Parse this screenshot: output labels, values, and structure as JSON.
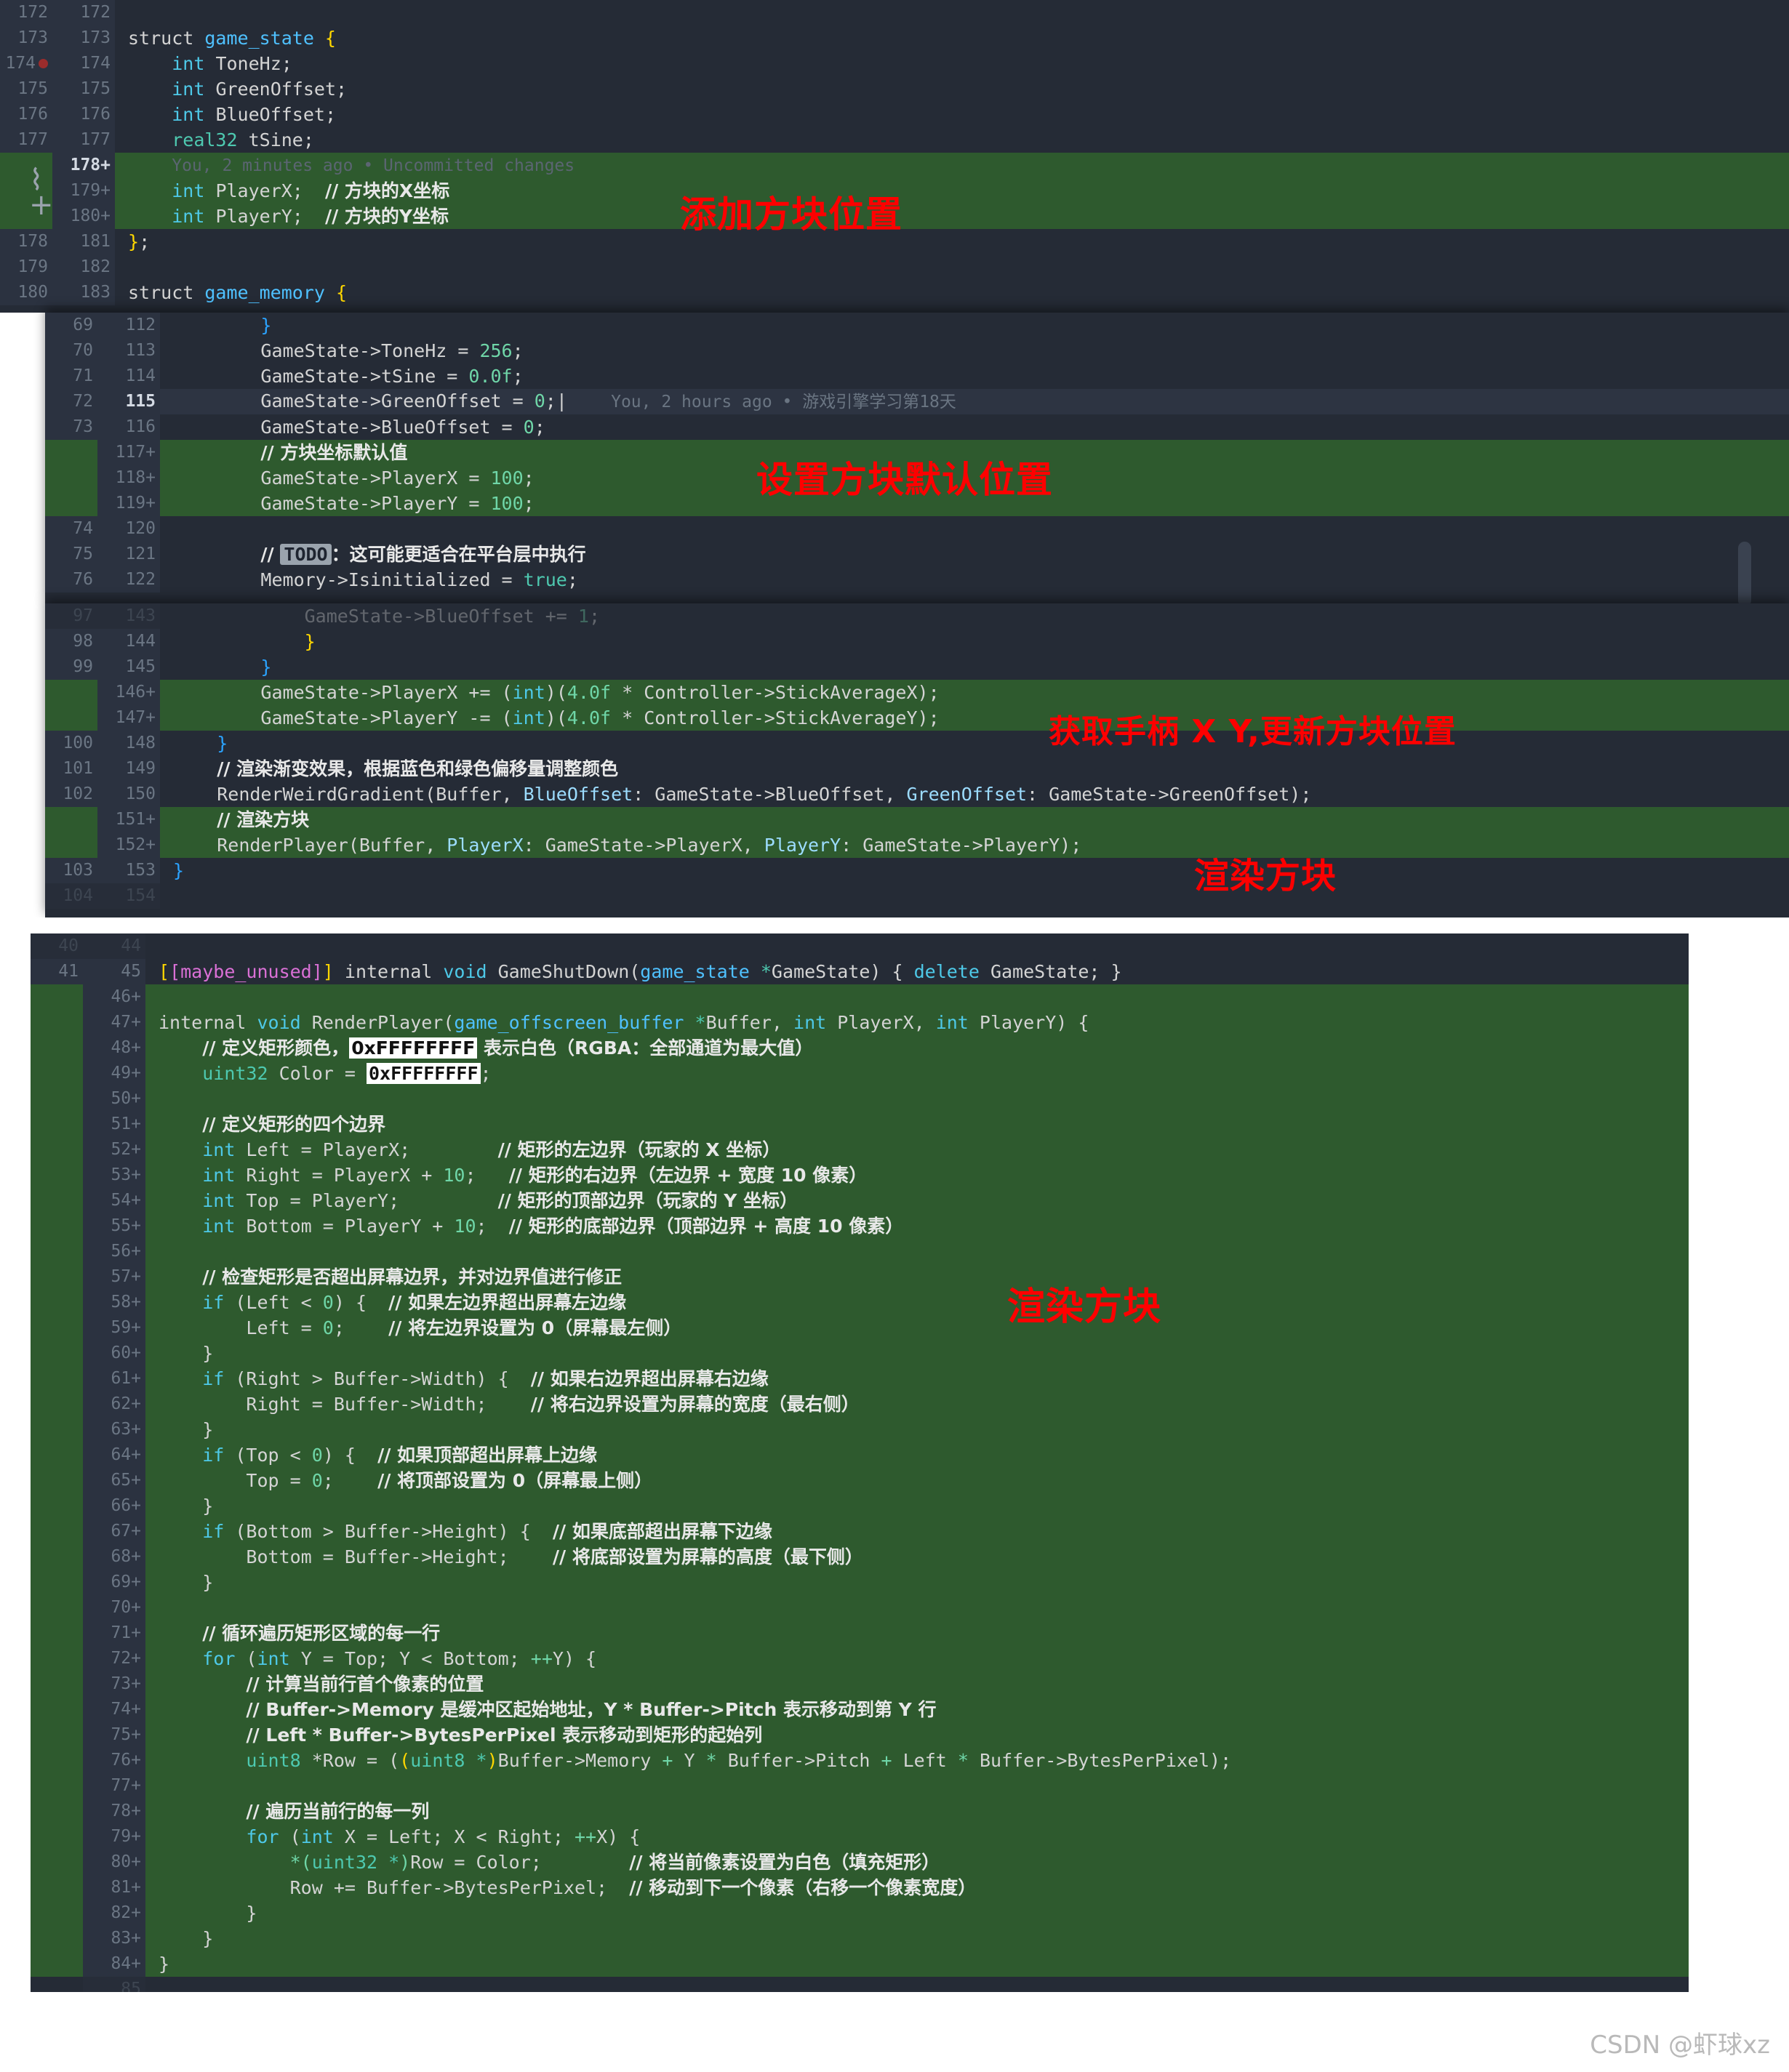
{
  "meta": {
    "watermark": "CSDN @虾球xz"
  },
  "panel_top": {
    "name": "game_state-struct-diff",
    "lines": [
      {
        "old": "172",
        "new": "172",
        "kind": "ctx",
        "html": ""
      },
      {
        "old": "173",
        "new": "173",
        "kind": "ctx",
        "html": "<span class='ident'>struct </span><span class='kw2'>game_state</span><span class='brace-y'> {</span>"
      },
      {
        "old": "174",
        "new": "174",
        "kind": "ctx",
        "bp": true,
        "html": "    <span class='kw'>int</span> <span class='ident'>ToneHz;</span>"
      },
      {
        "old": "175",
        "new": "175",
        "kind": "ctx",
        "html": "    <span class='kw'>int</span> <span class='ident'>GreenOffset;</span>"
      },
      {
        "old": "176",
        "new": "176",
        "kind": "ctx",
        "html": "    <span class='kw'>int</span> <span class='ident'>BlueOffset;</span>"
      },
      {
        "old": "177",
        "new": "177",
        "kind": "ctx",
        "html": "    <span class='type'>real32</span> <span class='ident'>tSine;</span>"
      },
      {
        "old": "",
        "new": "178+",
        "kind": "add",
        "cur": true,
        "html": "    <span class='blame'>You, 2 minutes ago • Uncommitted changes</span>"
      },
      {
        "old": "",
        "new": "179+",
        "kind": "add",
        "html": "    <span class='kw'>int</span> <span class='ident'>PlayerX;</span>  <span class='cmt-cn'>// 方块的X坐标</span>"
      },
      {
        "old": "",
        "new": "180+",
        "kind": "add",
        "html": "    <span class='kw'>int</span> <span class='ident'>PlayerY;</span>  <span class='cmt-cn'>// 方块的Y坐标</span>"
      },
      {
        "old": "178",
        "new": "181",
        "kind": "ctx",
        "html": "<span class='brace-y'>}</span><span class='ident'>;</span>"
      },
      {
        "old": "179",
        "new": "182",
        "kind": "ctx",
        "html": ""
      },
      {
        "old": "180",
        "new": "183",
        "kind": "ctx",
        "html": "<span class='ident'>struct </span><span class='kw2'>game_memory</span><span class='brace-y'> {</span>"
      }
    ],
    "annotation": "添加方块位置"
  },
  "panel_mid": {
    "name": "gamestate-init-diff",
    "lines": [
      {
        "old": "69",
        "new": "112",
        "kind": "ctx",
        "html": "        <span class='brace-b'>}</span>"
      },
      {
        "old": "70",
        "new": "113",
        "kind": "ctx",
        "html": "        <span class='ident'>GameState-&gt;ToneHz = </span><span class='num'>256</span><span class='ident'>;</span>"
      },
      {
        "old": "71",
        "new": "114",
        "kind": "ctx",
        "html": "        <span class='ident'>GameState-&gt;tSine = </span><span class='num'>0.0f</span><span class='ident'>;</span>"
      },
      {
        "old": "72",
        "new": "115",
        "kind": "cur",
        "html": "        <span class='ident'>GameState-&gt;GreenOffset = </span><span class='num'>0</span><span class='ident'>;|</span>    <span class='blame2'>You, 2 hours ago • 游戏引擎学习第18天</span>"
      },
      {
        "old": "73",
        "new": "116",
        "kind": "ctx",
        "html": "        <span class='ident'>GameState-&gt;BlueOffset = </span><span class='num'>0</span><span class='ident'>;</span>"
      },
      {
        "old": "",
        "new": "117+",
        "kind": "add",
        "html": "        <span class='cmt-cn'>// 方块坐标默认值</span>"
      },
      {
        "old": "",
        "new": "118+",
        "kind": "add",
        "html": "        <span class='ident'>GameState-&gt;PlayerX = </span><span class='num'>100</span><span class='ident'>;</span>"
      },
      {
        "old": "",
        "new": "119+",
        "kind": "add",
        "html": "        <span class='ident'>GameState-&gt;PlayerY = </span><span class='num'>100</span><span class='ident'>;</span>"
      },
      {
        "old": "74",
        "new": "120",
        "kind": "ctx",
        "html": ""
      },
      {
        "old": "75",
        "new": "121",
        "kind": "ctx",
        "html": "        <span class='cmt-cn'>// <span class='todo-chip'>TODO</span>：这可能更适合在平台层中执行</span>"
      },
      {
        "old": "76",
        "new": "122",
        "kind": "ctx",
        "html": "        <span class='ident'>Memory-&gt;Isinitialized = </span><span class='bool'>true</span><span class='ident'>;</span>"
      }
    ],
    "annotation": "设置方块默认位置"
  },
  "panel_low": {
    "name": "update-render-diff",
    "lines": [
      {
        "old": "97",
        "new": "143",
        "kind": "faded",
        "html": "            <span class='ident'>GameState-&gt;BlueOffset += </span><span class='num'>1</span><span class='ident'>;</span>"
      },
      {
        "old": "98",
        "new": "144",
        "kind": "ctx",
        "html": "            <span class='brace-y'>}</span>"
      },
      {
        "old": "99",
        "new": "145",
        "kind": "ctx",
        "html": "        <span class='brace-b'>}</span>"
      },
      {
        "old": "",
        "new": "146+",
        "kind": "add",
        "html": "        <span class='ident'>GameState-&gt;PlayerX += (</span><span class='kw'>int</span><span class='ident'>)(</span><span class='num'>4.0f</span><span class='ident'> * Controller-&gt;StickAverageX);</span>"
      },
      {
        "old": "",
        "new": "147+",
        "kind": "add",
        "html": "        <span class='ident'>GameState-&gt;PlayerY -= (</span><span class='kw'>int</span><span class='ident'>)(</span><span class='num'>4.0f</span><span class='ident'> * Controller-&gt;StickAverageY);</span>"
      },
      {
        "old": "100",
        "new": "148",
        "kind": "ctx",
        "html": "    <span class='brace-b'>}</span>"
      },
      {
        "old": "101",
        "new": "149",
        "kind": "ctx",
        "html": "    <span class='cmt-cn'>// 渲染渐变效果，根据蓝色和绿色偏移量调整颜色</span>"
      },
      {
        "old": "102",
        "new": "150",
        "kind": "ctx",
        "html": "    <span class='ident'>RenderWeirdGradient(Buffer, </span><span class='param'>BlueOffset</span><span class='ident'>: GameState-&gt;BlueOffset, </span><span class='param'>GreenOffset</span><span class='ident'>: GameState-&gt;GreenOffset);</span>"
      },
      {
        "old": "",
        "new": "151+",
        "kind": "add",
        "html": "    <span class='cmt-cn'>// 渲染方块</span>"
      },
      {
        "old": "",
        "new": "152+",
        "kind": "add",
        "html": "    <span class='ident'>RenderPlayer(Buffer, </span><span class='param'>PlayerX</span><span class='ident'>: GameState-&gt;PlayerX, </span><span class='param'>PlayerY</span><span class='ident'>: GameState-&gt;PlayerY);</span>"
      },
      {
        "old": "103",
        "new": "153",
        "kind": "ctx",
        "html": "<span class='brace-b'>}</span>"
      },
      {
        "old": "104",
        "new": "154",
        "kind": "faded",
        "html": ""
      }
    ],
    "annotation_controller": "获取手柄 X Y,更新方块位置",
    "annotation_render": "渲染方块"
  },
  "panel_bottom": {
    "name": "renderplayer-implementation-diff",
    "lines": [
      {
        "old": "40",
        "new": "44",
        "kind": "faded",
        "html": ""
      },
      {
        "old": "41",
        "new": "45",
        "kind": "ctx",
        "html": "<span class='brace-y'>[</span><span class='brace-m'>[maybe_unused]</span><span class='brace-y'>]</span><span class='ident'> internal </span><span class='kw'>void</span><span class='ident'> GameShutDown(</span><span class='kw2'>game_state</span><span class='type'> *</span><span class='ident'>GameState) { </span><span class='kw'>delete</span><span class='ident'> GameState; }</span>"
      },
      {
        "old": "",
        "new": "46+",
        "kind": "add",
        "html": ""
      },
      {
        "old": "",
        "new": "47+",
        "kind": "add",
        "html": "<span class='ident'>internal </span><span class='kw'>void</span><span class='ident'> RenderPlayer(</span><span class='kw2'>game_offscreen_buffer</span><span class='type'> *</span><span class='ident'>Buffer, </span><span class='kw'>int</span><span class='ident'> PlayerX, </span><span class='kw'>int</span><span class='ident'> PlayerY) {</span>"
      },
      {
        "old": "",
        "new": "48+",
        "kind": "add",
        "html": "    <span class='cmt-cn'>// 定义矩形颜色，<span class='hexchip'>0xFFFFFFFF</span> 表示白色（RGBA：全部通道为最大值）</span>"
      },
      {
        "old": "",
        "new": "49+",
        "kind": "add",
        "html": "    <span class='type'>uint32</span><span class='ident'> Color = </span><span class='hexchip'>0xFFFFFFFF</span><span class='ident'>;</span>"
      },
      {
        "old": "",
        "new": "50+",
        "kind": "add",
        "html": ""
      },
      {
        "old": "",
        "new": "51+",
        "kind": "add",
        "html": "    <span class='cmt-cn'>// 定义矩形的四个边界</span>"
      },
      {
        "old": "",
        "new": "52+",
        "kind": "add",
        "html": "    <span class='kw'>int</span><span class='ident'> Left = PlayerX;</span>        <span class='cmt-cn'>// 矩形的左边界（玩家的 X 坐标）</span>"
      },
      {
        "old": "",
        "new": "53+",
        "kind": "add",
        "html": "    <span class='kw'>int</span><span class='ident'> Right = PlayerX + </span><span class='num'>10</span><span class='ident'>;</span>   <span class='cmt-cn'>// 矩形的右边界（左边界 + 宽度 10 像素）</span>"
      },
      {
        "old": "",
        "new": "54+",
        "kind": "add",
        "html": "    <span class='kw'>int</span><span class='ident'> Top = PlayerY;</span>         <span class='cmt-cn'>// 矩形的顶部边界（玩家的 Y 坐标）</span>"
      },
      {
        "old": "",
        "new": "55+",
        "kind": "add",
        "html": "    <span class='kw'>int</span><span class='ident'> Bottom = PlayerY + </span><span class='num'>10</span><span class='ident'>;</span>  <span class='cmt-cn'>// 矩形的底部边界（顶部边界 + 高度 10 像素）</span>"
      },
      {
        "old": "",
        "new": "56+",
        "kind": "add",
        "html": ""
      },
      {
        "old": "",
        "new": "57+",
        "kind": "add",
        "html": "    <span class='cmt-cn'>// 检查矩形是否超出屏幕边界，并对边界值进行修正</span>"
      },
      {
        "old": "",
        "new": "58+",
        "kind": "add",
        "html": "    <span class='kw'>if</span><span class='ident'> (Left &lt; </span><span class='num'>0</span><span class='ident'>) {</span>  <span class='cmt-cn'>// 如果左边界超出屏幕左边缘</span>"
      },
      {
        "old": "",
        "new": "59+",
        "kind": "add",
        "html": "        <span class='ident'>Left = </span><span class='num'>0</span><span class='ident'>;</span>    <span class='cmt-cn'>// 将左边界设置为 0（屏幕最左侧）</span>"
      },
      {
        "old": "",
        "new": "60+",
        "kind": "add",
        "html": "    <span class='ident'>}</span>"
      },
      {
        "old": "",
        "new": "61+",
        "kind": "add",
        "html": "    <span class='kw'>if</span><span class='ident'> (Right &gt; Buffer-&gt;Width) {</span>  <span class='cmt-cn'>// 如果右边界超出屏幕右边缘</span>"
      },
      {
        "old": "",
        "new": "62+",
        "kind": "add",
        "html": "        <span class='ident'>Right = Buffer-&gt;Width;</span>    <span class='cmt-cn'>// 将右边界设置为屏幕的宽度（最右侧）</span>"
      },
      {
        "old": "",
        "new": "63+",
        "kind": "add",
        "html": "    <span class='ident'>}</span>"
      },
      {
        "old": "",
        "new": "64+",
        "kind": "add",
        "html": "    <span class='kw'>if</span><span class='ident'> (Top &lt; </span><span class='num'>0</span><span class='ident'>) {</span>  <span class='cmt-cn'>// 如果顶部超出屏幕上边缘</span>"
      },
      {
        "old": "",
        "new": "65+",
        "kind": "add",
        "html": "        <span class='ident'>Top = </span><span class='num'>0</span><span class='ident'>;</span>    <span class='cmt-cn'>// 将顶部设置为 0（屏幕最上侧）</span>"
      },
      {
        "old": "",
        "new": "66+",
        "kind": "add",
        "html": "    <span class='ident'>}</span>"
      },
      {
        "old": "",
        "new": "67+",
        "kind": "add",
        "html": "    <span class='kw'>if</span><span class='ident'> (Bottom &gt; Buffer-&gt;Height) {</span>  <span class='cmt-cn'>// 如果底部超出屏幕下边缘</span>"
      },
      {
        "old": "",
        "new": "68+",
        "kind": "add",
        "html": "        <span class='ident'>Bottom = Buffer-&gt;Height;</span>    <span class='cmt-cn'>// 将底部设置为屏幕的高度（最下侧）</span>"
      },
      {
        "old": "",
        "new": "69+",
        "kind": "add",
        "html": "    <span class='ident'>}</span>"
      },
      {
        "old": "",
        "new": "70+",
        "kind": "add",
        "html": ""
      },
      {
        "old": "",
        "new": "71+",
        "kind": "add",
        "html": "    <span class='cmt-cn'>// 循环遍历矩形区域的每一行</span>"
      },
      {
        "old": "",
        "new": "72+",
        "kind": "add",
        "html": "    <span class='kw'>for</span><span class='ident'> (</span><span class='kw'>int</span><span class='ident'> Y = Top; Y &lt; Bottom; </span><span class='num'>++</span><span class='ident'>Y) {</span>"
      },
      {
        "old": "",
        "new": "73+",
        "kind": "add",
        "html": "        <span class='cmt-cn'>// 计算当前行首个像素的位置</span>"
      },
      {
        "old": "",
        "new": "74+",
        "kind": "add",
        "html": "        <span class='cmt-cn'>// Buffer-&gt;Memory 是缓冲区起始地址，Y * Buffer-&gt;Pitch 表示移动到第 Y 行</span>"
      },
      {
        "old": "",
        "new": "75+",
        "kind": "add",
        "html": "        <span class='cmt-cn'>// Left * Buffer-&gt;BytesPerPixel 表示移动到矩形的起始列</span>"
      },
      {
        "old": "",
        "new": "76+",
        "kind": "add",
        "html": "        <span class='type'>uint8</span><span class='ident'> *Row = (</span><span class='brace-y'>(</span><span class='type'>uint8 *</span><span class='brace-y'>)</span><span class='ident'>Buffer-&gt;Memory </span><span class='num'>+</span><span class='ident'> Y </span><span class='num'>*</span><span class='ident'> Buffer-&gt;Pitch </span><span class='num'>+</span><span class='ident'> Left </span><span class='num'>*</span><span class='ident'> Buffer-&gt;BytesPerPixel);</span>"
      },
      {
        "old": "",
        "new": "77+",
        "kind": "add",
        "html": ""
      },
      {
        "old": "",
        "new": "78+",
        "kind": "add",
        "html": "        <span class='cmt-cn'>// 遍历当前行的每一列</span>"
      },
      {
        "old": "",
        "new": "79+",
        "kind": "add",
        "html": "        <span class='kw'>for</span><span class='ident'> (</span><span class='kw'>int</span><span class='ident'> X = Left; X &lt; Right; </span><span class='num'>++</span><span class='ident'>X) {</span>"
      },
      {
        "old": "",
        "new": "80+",
        "kind": "add",
        "html": "            <span class='num'>*(</span><span class='type'>uint32 *</span><span class='num'>)</span><span class='ident'>Row = Color;</span>        <span class='cmt-cn'>// 将当前像素设置为白色（填充矩形）</span>"
      },
      {
        "old": "",
        "new": "81+",
        "kind": "add",
        "html": "            <span class='ident'>Row += Buffer-&gt;BytesPerPixel;</span>  <span class='cmt-cn'>// 移动到下一个像素（右移一个像素宽度）</span>"
      },
      {
        "old": "",
        "new": "82+",
        "kind": "add",
        "html": "        <span class='ident'>}</span>"
      },
      {
        "old": "",
        "new": "83+",
        "kind": "add",
        "html": "    <span class='ident'>}</span>"
      },
      {
        "old": "",
        "new": "84+",
        "kind": "add",
        "html": "<span class='ident'>}</span>"
      },
      {
        "old": "",
        "new": "85",
        "kind": "faded",
        "html": ""
      }
    ],
    "annotation": "渲染方块"
  }
}
